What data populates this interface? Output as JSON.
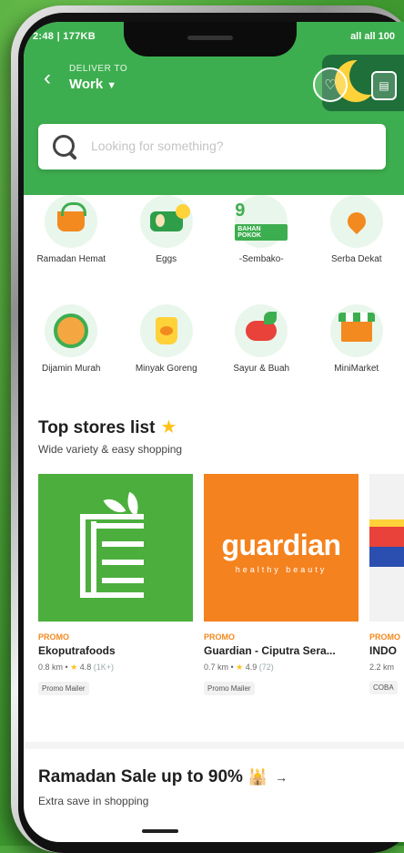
{
  "status_bar": {
    "left": "2:48 | 177KB",
    "right": "all all 100"
  },
  "header": {
    "deliver_label": "DELIVER TO",
    "location": "Work",
    "back_icon": "chevron-left-icon"
  },
  "search": {
    "placeholder": "Looking for something?"
  },
  "categories": [
    {
      "label": "Ramadan Hemat",
      "icon": "basket-icon"
    },
    {
      "label": "Eggs",
      "icon": "eggs-icon"
    },
    {
      "label": "-Sembako-",
      "icon": "sembako-icon",
      "badge_text": "9",
      "badge_sub": "BAHAN POKOK"
    },
    {
      "label": "Serba Dekat",
      "icon": "location-pin-icon"
    },
    {
      "label": "Dijamin Murah",
      "icon": "badge-icon"
    },
    {
      "label": "Minyak Goreng",
      "icon": "oil-bag-icon"
    },
    {
      "label": "Sayur & Buah",
      "icon": "vegetables-icon"
    },
    {
      "label": "MiniMarket",
      "icon": "store-icon"
    }
  ],
  "top_stores": {
    "title": "Top stores list",
    "subtitle": "Wide variety & easy shopping",
    "stores": [
      {
        "promo": "PROMO",
        "name": "Ekoputrafoods",
        "distance": "0.8 km",
        "rating": "4.8",
        "reviews": "(1K+)",
        "chip": "Promo Mailer"
      },
      {
        "promo": "PROMO",
        "name": "Guardian - Ciputra Sera...",
        "distance": "0.7 km",
        "rating": "4.9",
        "reviews": "(72)",
        "chip": "Promo Mailer",
        "logo_text": "guardian",
        "logo_tag": "healthy beauty"
      },
      {
        "promo": "PROMO",
        "name": "INDO",
        "distance": "2.2 km",
        "rating": "",
        "reviews": "",
        "chip": "COBA"
      }
    ]
  },
  "ramadan": {
    "title": "Ramadan Sale up to 90%",
    "subtitle": "Extra save in shopping"
  },
  "colors": {
    "brand_green": "#3dae4f",
    "promo_orange": "#f28a1f",
    "star": "#ffc21a"
  }
}
